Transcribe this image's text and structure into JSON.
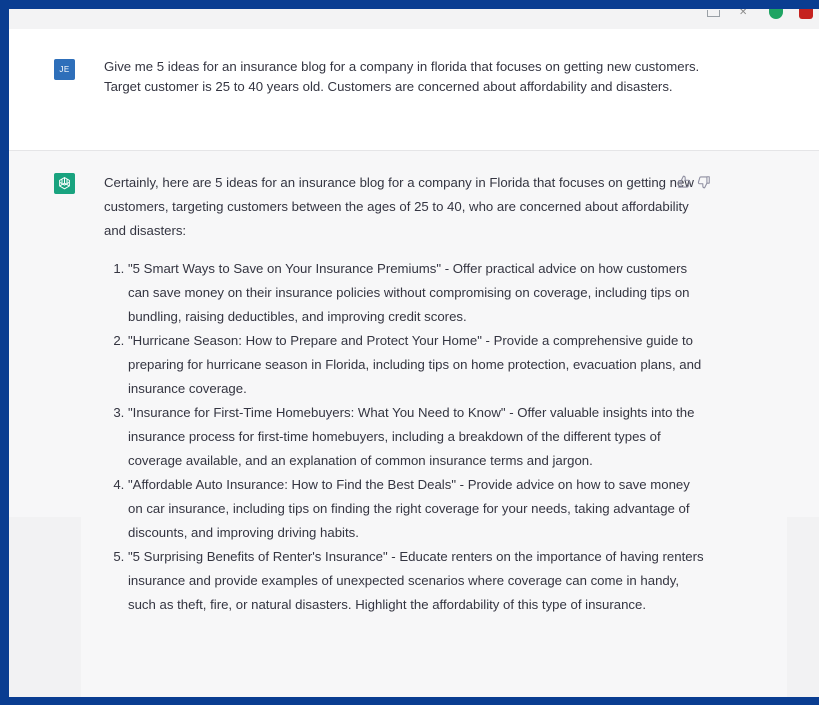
{
  "user_message": {
    "avatar_initials": "JE",
    "text": "Give me 5 ideas for an insurance blog for a company in florida that focuses on getting new customers. Target customer is 25 to 40 years old. Customers are concerned about affordability and disasters."
  },
  "assistant_message": {
    "intro": "Certainly, here are 5 ideas for an insurance blog for a company in Florida that focuses on getting new customers, targeting customers between the ages of 25 to 40, who are concerned about affordability and disasters:",
    "items": [
      "\"5 Smart Ways to Save on Your Insurance Premiums\" - Offer practical advice on how customers can save money on their insurance policies without compromising on coverage, including tips on bundling, raising deductibles, and improving credit scores.",
      "\"Hurricane Season: How to Prepare and Protect Your Home\" - Provide a comprehensive guide to preparing for hurricane season in Florida, including tips on home protection, evacuation plans, and insurance coverage.",
      "\"Insurance for First-Time Homebuyers: What You Need to Know\" - Offer valuable insights into the insurance process for first-time homebuyers, including a breakdown of the different types of coverage available, and an explanation of common insurance terms and jargon.",
      "\"Affordable Auto Insurance: How to Find the Best Deals\" - Provide advice on how to save money on car insurance, including tips on finding the right coverage for your needs, taking advantage of discounts, and improving driving habits.",
      "\"5 Surprising Benefits of Renter's Insurance\" - Educate renters on the importance of having renters insurance and provide examples of unexpected scenarios where coverage can come in handy, such as theft, fire, or natural disasters. Highlight the affordability of this type of insurance."
    ]
  },
  "icons": {
    "thumbs_up": "thumbs-up-icon",
    "thumbs_down": "thumbs-down-icon",
    "assistant_avatar": "openai-logo-icon"
  },
  "colors": {
    "frame_border": "#0a3d91",
    "user_avatar_bg": "#2e6fba",
    "assistant_avatar_bg": "#19a37f",
    "assistant_bg": "#f7f7f8",
    "text": "#343541"
  }
}
